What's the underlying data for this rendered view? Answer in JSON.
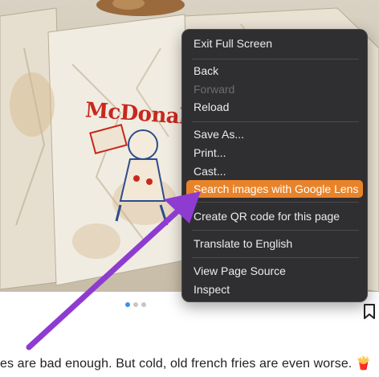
{
  "photo": {
    "brand_text": "McDonald's",
    "wordmark_color": "#c8281e"
  },
  "context_menu": {
    "items": [
      {
        "label": "Exit Full Screen"
      },
      {
        "label": "Back"
      },
      {
        "label": "Forward",
        "disabled": true
      },
      {
        "label": "Reload"
      },
      {
        "label": "Save As..."
      },
      {
        "label": "Print..."
      },
      {
        "label": "Cast..."
      },
      {
        "label": "Search images with Google Lens",
        "highlighted": true
      },
      {
        "label": "Create QR code for this page"
      },
      {
        "label": "Translate to English"
      },
      {
        "label": "View Page Source"
      },
      {
        "label": "Inspect"
      }
    ],
    "highlight_color": "#e9832a",
    "background_color": "#2f2f31"
  },
  "carousel": {
    "dot_count": 3,
    "active_index": 0
  },
  "caption": {
    "text": "es are bad enough. But cold, old french fries are even worse.",
    "emoji": "🍟"
  },
  "annotation_arrow": {
    "color": "#8e3bd1",
    "icon": "arrow-pointer"
  },
  "icons": {
    "bookmark": "bookmark-icon"
  }
}
